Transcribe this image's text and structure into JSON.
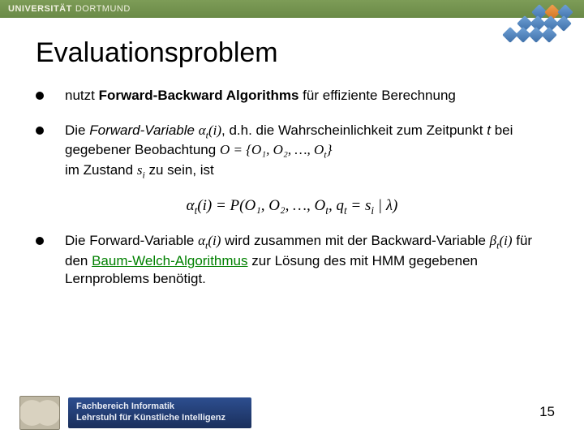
{
  "header": {
    "uni_strong": "UNIVERSITÄT",
    "uni_light": "DORTMUND"
  },
  "title": "Evaluationsproblem",
  "bullets": {
    "b1": {
      "pre": "nutzt ",
      "bold": "Forward-Backward Algorithms",
      "post": " für effiziente Berechnung"
    },
    "b2": {
      "t1": "Die ",
      "fv": "Forward-Variable",
      "sp": "   ",
      "alpha": "α",
      "alpha_sub": "t",
      "alpha_arg": "(i)",
      "t2": ", d.h. die Wahrscheinlichkeit zum Zeitpunkt ",
      "tvar": "t",
      "t3": " bei gegebener Beobachtung  ",
      "obs": "O = {O₁, O₂, …, O",
      "obs_sub": "t",
      "obs_close": "}",
      "t4": " im Zustand ",
      "si": "s",
      "si_sub": "i",
      "t5": " zu sein, ist"
    },
    "formula": {
      "lhs_a": "α",
      "lhs_sub": "t",
      "lhs_arg": "(i) = P(O₁, O₂, …, O",
      "ot_sub": "t",
      "mid": ", q",
      "qt_sub": "t",
      "eq": " = s",
      "si_sub": "i",
      "end": " | λ)"
    },
    "b3": {
      "t1": "Die Forward-Variable  ",
      "a": "α",
      "a_sub": "t",
      "a_arg": "(i)",
      "t2": "  wird zusammen mit der Backward-Variable   ",
      "b": "β",
      "b_sub": "t",
      "b_arg": "(i)",
      "t3": "   für den ",
      "link": "Baum-Welch-Algorithmus",
      "t4": " zur Lösung des mit HMM gegebenen Lernproblems benötigt."
    }
  },
  "footer": {
    "dept_line1": "Fachbereich Informatik",
    "dept_line2": "Lehrstuhl für Künstliche Intelligenz"
  },
  "page_number": "15"
}
